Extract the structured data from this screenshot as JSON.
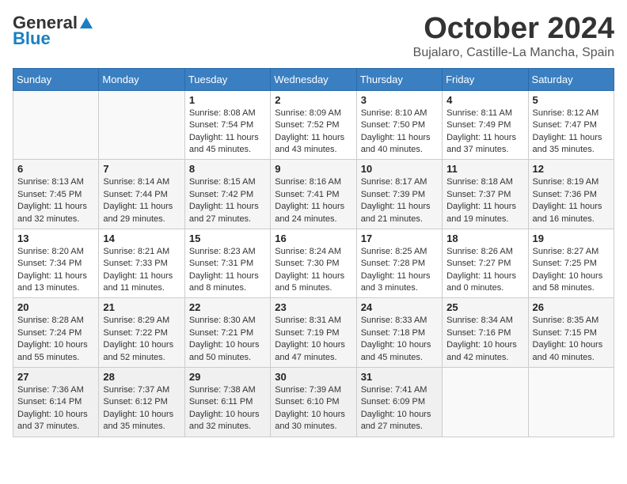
{
  "logo": {
    "general": "General",
    "blue": "Blue"
  },
  "title": {
    "month": "October 2024",
    "location": "Bujalaro, Castille-La Mancha, Spain"
  },
  "weekdays": [
    "Sunday",
    "Monday",
    "Tuesday",
    "Wednesday",
    "Thursday",
    "Friday",
    "Saturday"
  ],
  "weeks": [
    [
      {
        "day": "",
        "sunrise": "",
        "sunset": "",
        "daylight": ""
      },
      {
        "day": "",
        "sunrise": "",
        "sunset": "",
        "daylight": ""
      },
      {
        "day": "1",
        "sunrise": "Sunrise: 8:08 AM",
        "sunset": "Sunset: 7:54 PM",
        "daylight": "Daylight: 11 hours and 45 minutes."
      },
      {
        "day": "2",
        "sunrise": "Sunrise: 8:09 AM",
        "sunset": "Sunset: 7:52 PM",
        "daylight": "Daylight: 11 hours and 43 minutes."
      },
      {
        "day": "3",
        "sunrise": "Sunrise: 8:10 AM",
        "sunset": "Sunset: 7:50 PM",
        "daylight": "Daylight: 11 hours and 40 minutes."
      },
      {
        "day": "4",
        "sunrise": "Sunrise: 8:11 AM",
        "sunset": "Sunset: 7:49 PM",
        "daylight": "Daylight: 11 hours and 37 minutes."
      },
      {
        "day": "5",
        "sunrise": "Sunrise: 8:12 AM",
        "sunset": "Sunset: 7:47 PM",
        "daylight": "Daylight: 11 hours and 35 minutes."
      }
    ],
    [
      {
        "day": "6",
        "sunrise": "Sunrise: 8:13 AM",
        "sunset": "Sunset: 7:45 PM",
        "daylight": "Daylight: 11 hours and 32 minutes."
      },
      {
        "day": "7",
        "sunrise": "Sunrise: 8:14 AM",
        "sunset": "Sunset: 7:44 PM",
        "daylight": "Daylight: 11 hours and 29 minutes."
      },
      {
        "day": "8",
        "sunrise": "Sunrise: 8:15 AM",
        "sunset": "Sunset: 7:42 PM",
        "daylight": "Daylight: 11 hours and 27 minutes."
      },
      {
        "day": "9",
        "sunrise": "Sunrise: 8:16 AM",
        "sunset": "Sunset: 7:41 PM",
        "daylight": "Daylight: 11 hours and 24 minutes."
      },
      {
        "day": "10",
        "sunrise": "Sunrise: 8:17 AM",
        "sunset": "Sunset: 7:39 PM",
        "daylight": "Daylight: 11 hours and 21 minutes."
      },
      {
        "day": "11",
        "sunrise": "Sunrise: 8:18 AM",
        "sunset": "Sunset: 7:37 PM",
        "daylight": "Daylight: 11 hours and 19 minutes."
      },
      {
        "day": "12",
        "sunrise": "Sunrise: 8:19 AM",
        "sunset": "Sunset: 7:36 PM",
        "daylight": "Daylight: 11 hours and 16 minutes."
      }
    ],
    [
      {
        "day": "13",
        "sunrise": "Sunrise: 8:20 AM",
        "sunset": "Sunset: 7:34 PM",
        "daylight": "Daylight: 11 hours and 13 minutes."
      },
      {
        "day": "14",
        "sunrise": "Sunrise: 8:21 AM",
        "sunset": "Sunset: 7:33 PM",
        "daylight": "Daylight: 11 hours and 11 minutes."
      },
      {
        "day": "15",
        "sunrise": "Sunrise: 8:23 AM",
        "sunset": "Sunset: 7:31 PM",
        "daylight": "Daylight: 11 hours and 8 minutes."
      },
      {
        "day": "16",
        "sunrise": "Sunrise: 8:24 AM",
        "sunset": "Sunset: 7:30 PM",
        "daylight": "Daylight: 11 hours and 5 minutes."
      },
      {
        "day": "17",
        "sunrise": "Sunrise: 8:25 AM",
        "sunset": "Sunset: 7:28 PM",
        "daylight": "Daylight: 11 hours and 3 minutes."
      },
      {
        "day": "18",
        "sunrise": "Sunrise: 8:26 AM",
        "sunset": "Sunset: 7:27 PM",
        "daylight": "Daylight: 11 hours and 0 minutes."
      },
      {
        "day": "19",
        "sunrise": "Sunrise: 8:27 AM",
        "sunset": "Sunset: 7:25 PM",
        "daylight": "Daylight: 10 hours and 58 minutes."
      }
    ],
    [
      {
        "day": "20",
        "sunrise": "Sunrise: 8:28 AM",
        "sunset": "Sunset: 7:24 PM",
        "daylight": "Daylight: 10 hours and 55 minutes."
      },
      {
        "day": "21",
        "sunrise": "Sunrise: 8:29 AM",
        "sunset": "Sunset: 7:22 PM",
        "daylight": "Daylight: 10 hours and 52 minutes."
      },
      {
        "day": "22",
        "sunrise": "Sunrise: 8:30 AM",
        "sunset": "Sunset: 7:21 PM",
        "daylight": "Daylight: 10 hours and 50 minutes."
      },
      {
        "day": "23",
        "sunrise": "Sunrise: 8:31 AM",
        "sunset": "Sunset: 7:19 PM",
        "daylight": "Daylight: 10 hours and 47 minutes."
      },
      {
        "day": "24",
        "sunrise": "Sunrise: 8:33 AM",
        "sunset": "Sunset: 7:18 PM",
        "daylight": "Daylight: 10 hours and 45 minutes."
      },
      {
        "day": "25",
        "sunrise": "Sunrise: 8:34 AM",
        "sunset": "Sunset: 7:16 PM",
        "daylight": "Daylight: 10 hours and 42 minutes."
      },
      {
        "day": "26",
        "sunrise": "Sunrise: 8:35 AM",
        "sunset": "Sunset: 7:15 PM",
        "daylight": "Daylight: 10 hours and 40 minutes."
      }
    ],
    [
      {
        "day": "27",
        "sunrise": "Sunrise: 7:36 AM",
        "sunset": "Sunset: 6:14 PM",
        "daylight": "Daylight: 10 hours and 37 minutes."
      },
      {
        "day": "28",
        "sunrise": "Sunrise: 7:37 AM",
        "sunset": "Sunset: 6:12 PM",
        "daylight": "Daylight: 10 hours and 35 minutes."
      },
      {
        "day": "29",
        "sunrise": "Sunrise: 7:38 AM",
        "sunset": "Sunset: 6:11 PM",
        "daylight": "Daylight: 10 hours and 32 minutes."
      },
      {
        "day": "30",
        "sunrise": "Sunrise: 7:39 AM",
        "sunset": "Sunset: 6:10 PM",
        "daylight": "Daylight: 10 hours and 30 minutes."
      },
      {
        "day": "31",
        "sunrise": "Sunrise: 7:41 AM",
        "sunset": "Sunset: 6:09 PM",
        "daylight": "Daylight: 10 hours and 27 minutes."
      },
      {
        "day": "",
        "sunrise": "",
        "sunset": "",
        "daylight": ""
      },
      {
        "day": "",
        "sunrise": "",
        "sunset": "",
        "daylight": ""
      }
    ]
  ]
}
